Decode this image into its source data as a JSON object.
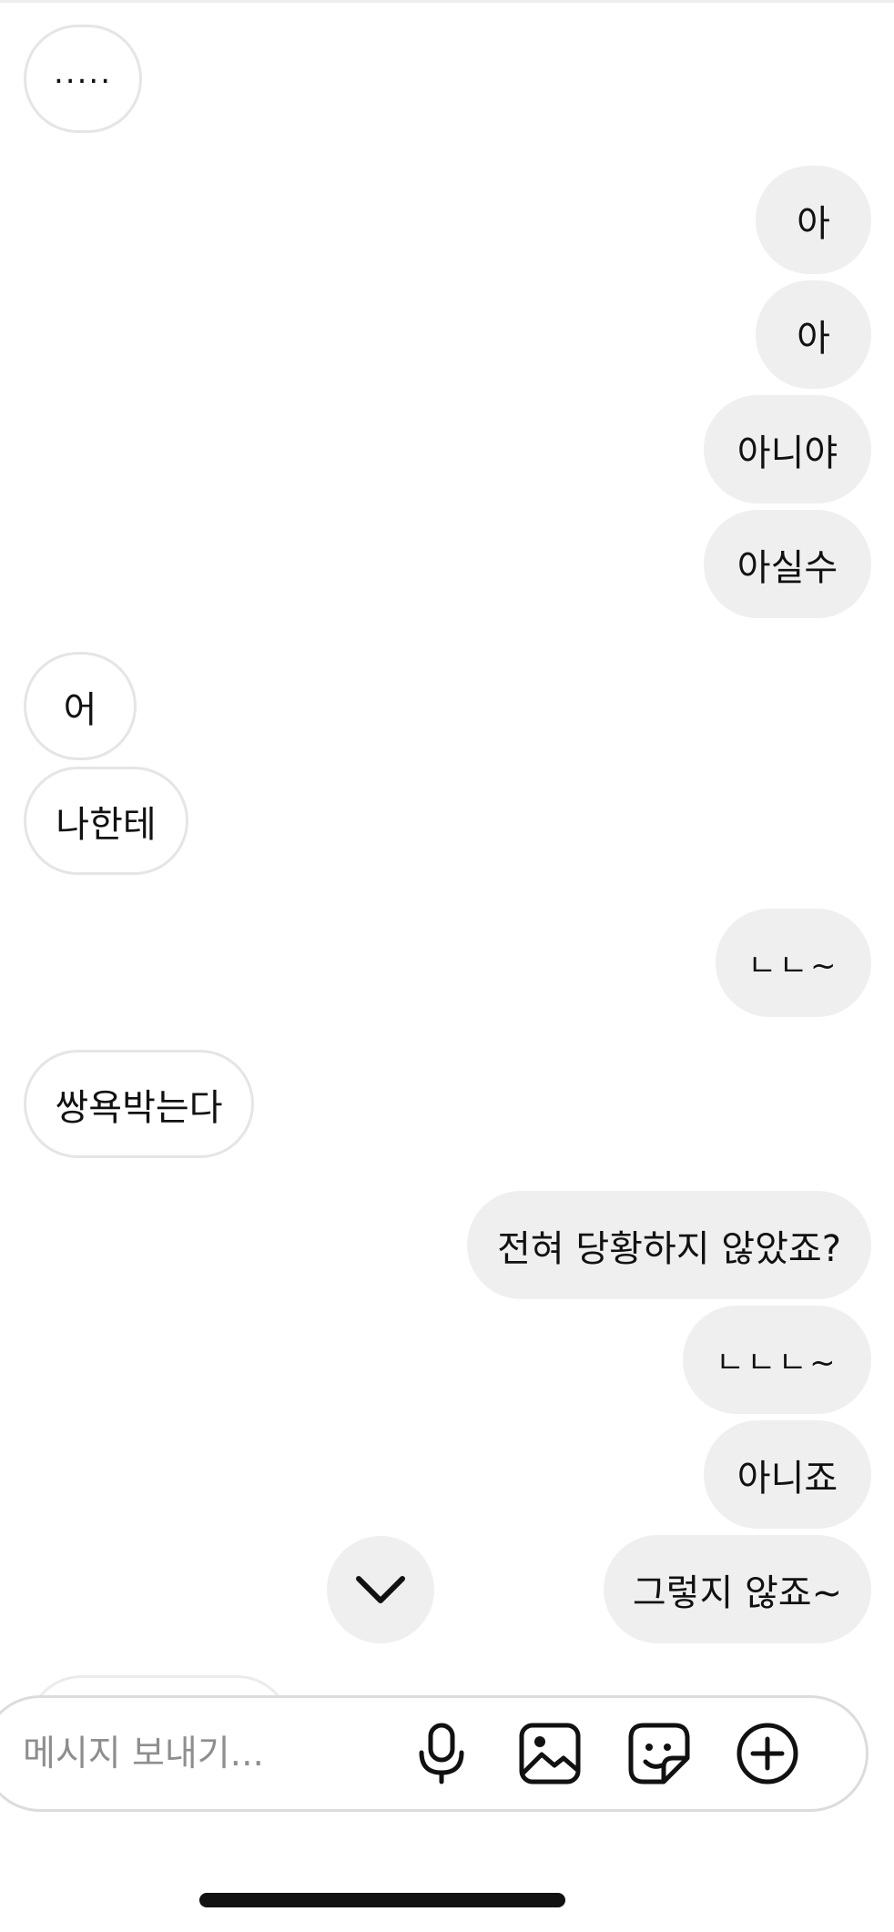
{
  "messages": [
    {
      "dir": "in",
      "text": "....."
    },
    {
      "dir": "out",
      "text": "아"
    },
    {
      "dir": "out",
      "text": "아"
    },
    {
      "dir": "out",
      "text": "아니야"
    },
    {
      "dir": "out",
      "text": "아실수"
    },
    {
      "dir": "in",
      "text": "어"
    },
    {
      "dir": "in",
      "text": "나한테"
    },
    {
      "dir": "out",
      "text": "ㄴㄴ~"
    },
    {
      "dir": "in",
      "text": "쌍욕박는다"
    },
    {
      "dir": "out",
      "text": "전혀 당황하지 않았죠?"
    },
    {
      "dir": "out",
      "text": "ㄴㄴㄴ~"
    },
    {
      "dir": "out",
      "text": "아니죠"
    },
    {
      "dir": "out",
      "text": "그렇지 않죠~"
    }
  ],
  "composer": {
    "placeholder": "메시지 보내기...",
    "icons": [
      "microphone-icon",
      "image-icon",
      "sticker-icon",
      "plus-circle-icon"
    ]
  },
  "scroll_down_icon": "chevron-down-icon",
  "colors": {
    "outgoing_bubble": "#efefef",
    "incoming_border": "#e5e5e5",
    "text": "#111111",
    "placeholder": "#8e8e8e"
  }
}
